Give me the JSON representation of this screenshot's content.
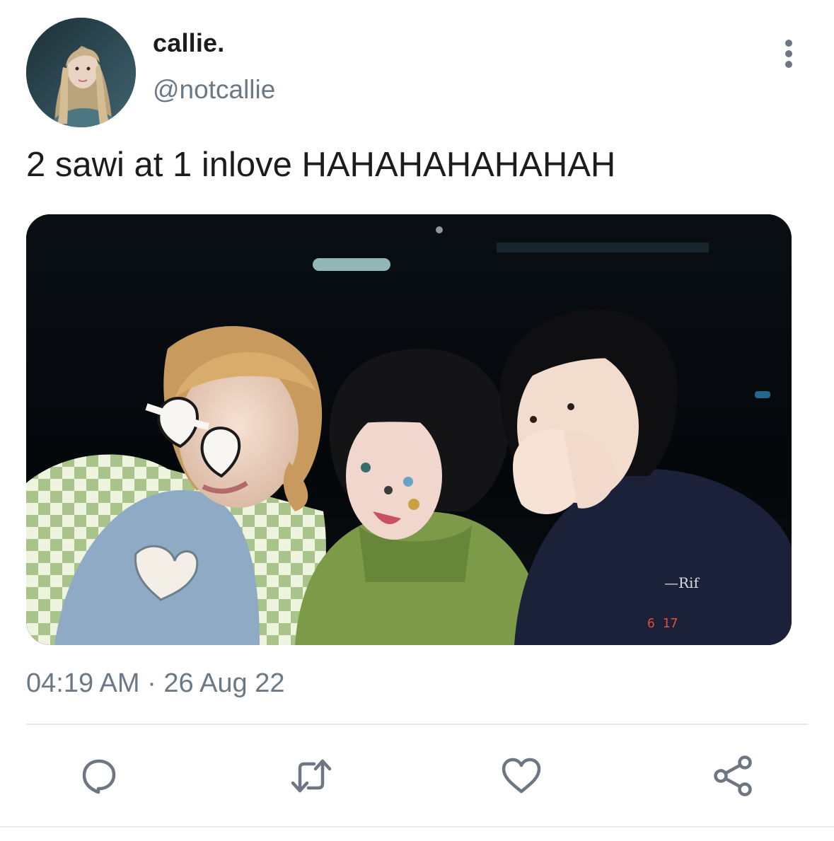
{
  "user": {
    "display_name": "callie.",
    "handle": "@notcallie",
    "avatar_icon": "profile-photo"
  },
  "tweet": {
    "text": "2 sawi at 1 inlove HAHAHAHAHAHAH",
    "time": "04:19 AM",
    "separator": "·",
    "date": "26 Aug 22",
    "photo_overlay_signature": "—Rif",
    "photo_overlay_date": "6 17"
  },
  "actions": [
    {
      "name": "reply",
      "icon": "speech-bubble-icon"
    },
    {
      "name": "retweet",
      "icon": "retweet-arrows-icon"
    },
    {
      "name": "like",
      "icon": "heart-icon"
    },
    {
      "name": "share",
      "icon": "share-nodes-icon"
    }
  ],
  "colors": {
    "name_text": "#1c1c1c",
    "secondary_text": "#6b7885",
    "icon_gray": "#6e7681",
    "divider": "#e2e7eb",
    "photo_date_stamp": "#e0503a"
  }
}
